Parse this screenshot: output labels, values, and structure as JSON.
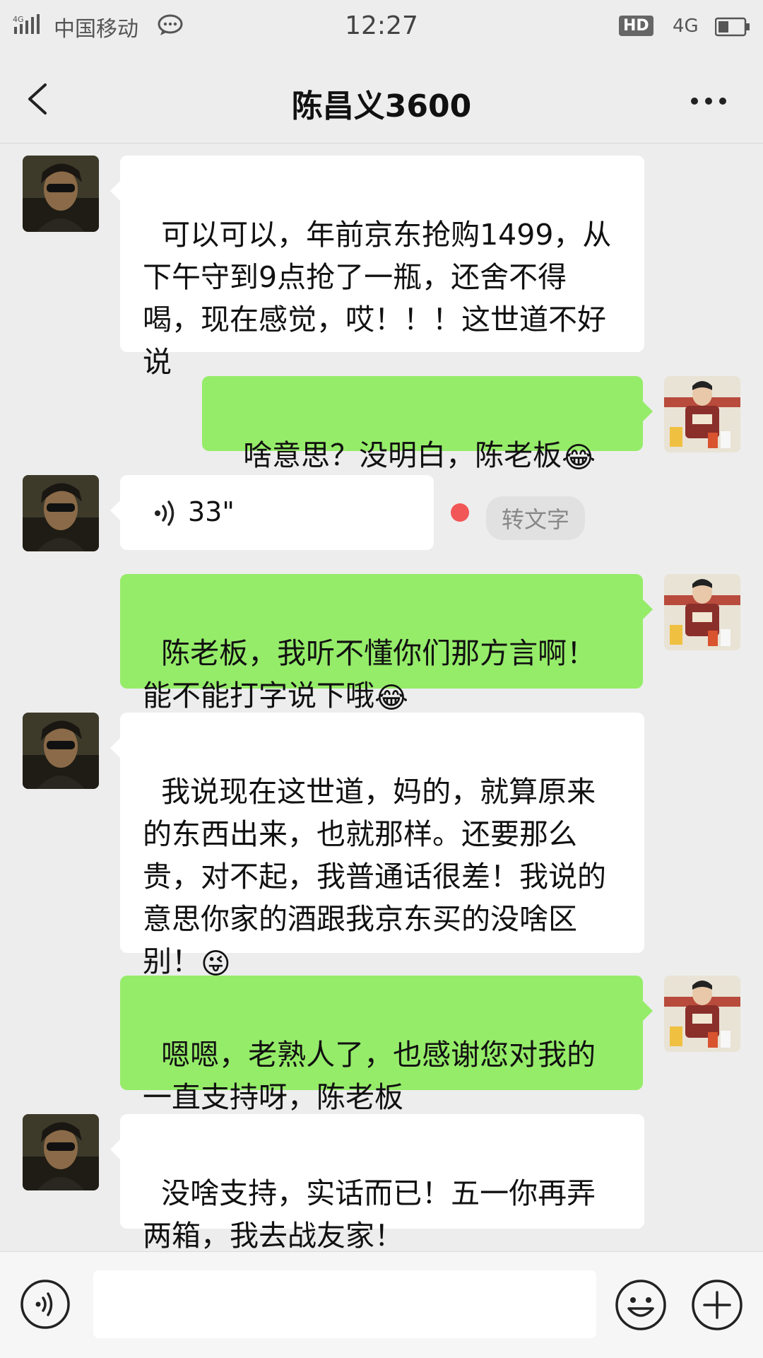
{
  "status_bar": {
    "signal_label": "4G",
    "carrier": "中国移动",
    "time": "12:27",
    "hd": "HD",
    "network": "4G"
  },
  "header": {
    "title": "陈昌义3600",
    "back_icon": "chevron-left-icon",
    "more_icon": "more-dots-icon"
  },
  "messages": [
    {
      "side": "in",
      "type": "text",
      "text": "可以可以，年前京东抢购1499，从下午守到9点抢了一瓶，还舍不得喝，现在感觉，哎！！！这世道不好说"
    },
    {
      "side": "out",
      "type": "text",
      "text": "啥意思？没明白，陈老板",
      "emoji": "😂"
    },
    {
      "side": "in",
      "type": "voice",
      "duration": "33\"",
      "convert_label": "转文字"
    },
    {
      "side": "out",
      "type": "text",
      "text": "陈老板，我听不懂你们那方言啊！能不能打字说下哦",
      "emoji": "😂"
    },
    {
      "side": "in",
      "type": "text",
      "text": "我说现在这世道，妈的，就算原来的东西出来，也就那样。还要那么贵，对不起，我普通话很差！我说的意思你家的酒跟我京东买的没啥区别！",
      "emoji": "😜"
    },
    {
      "side": "out",
      "type": "text",
      "text": "嗯嗯，老熟人了，也感谢您对我的一直支持呀，陈老板"
    },
    {
      "side": "in",
      "type": "text",
      "text": "没啥支持，实话而已！五一你再弄两箱，我去战友家！"
    }
  ],
  "input_bar": {
    "voice_icon": "voice-input-icon",
    "emoji_icon": "emoji-icon",
    "plus_icon": "plus-icon"
  },
  "colors": {
    "background": "#ededed",
    "incoming_bubble": "#ffffff",
    "outgoing_bubble": "#95ec69",
    "unread_dot": "#f25757"
  }
}
